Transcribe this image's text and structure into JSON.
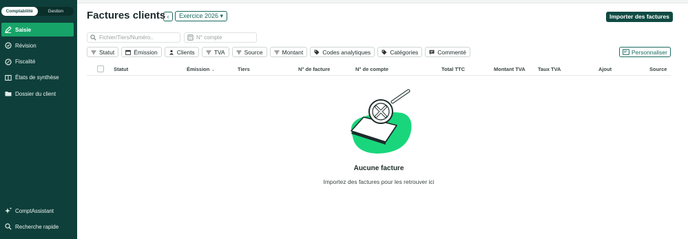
{
  "sidebar": {
    "toggle": {
      "left": "Comptabilité",
      "right": "Gestion"
    },
    "items": [
      {
        "label": "Saisie",
        "icon": "pencil-icon",
        "active": true
      },
      {
        "label": "Révision",
        "icon": "refresh-icon"
      },
      {
        "label": "Fiscalité",
        "icon": "percent-icon"
      },
      {
        "label": "États de synthèse",
        "icon": "book-icon"
      },
      {
        "label": "Dossier du client",
        "icon": "folder-icon"
      }
    ],
    "bottom": [
      {
        "label": "ComptAssistant",
        "icon": "sparkle-icon"
      },
      {
        "label": "Recherche rapide",
        "icon": "search-icon"
      }
    ]
  },
  "header": {
    "title": "Factures clients",
    "back_symbol": "‹",
    "exercise": "Exercice 2026 ▾",
    "import_label": "Importer des factures"
  },
  "search": {
    "placeholder": "Fichier/Tiers/Numéro..",
    "account_placeholder": "N° compte"
  },
  "filters": [
    {
      "label": "Statut",
      "icon": "filter-lines-icon"
    },
    {
      "label": "Émission",
      "icon": "calendar-icon"
    },
    {
      "label": "Clients",
      "icon": "users-icon"
    },
    {
      "label": "TVA",
      "icon": "filter-lines-icon"
    },
    {
      "label": "Source",
      "icon": "filter-lines-icon"
    },
    {
      "label": "Montant",
      "icon": "filter-lines-icon"
    },
    {
      "label": "Codes analytiques",
      "icon": "tag-icon"
    },
    {
      "label": "Catégories",
      "icon": "tag-icon"
    },
    {
      "label": "Commenté",
      "icon": "comment-icon"
    }
  ],
  "customize_label": "Personnaliser",
  "table": {
    "columns": [
      "Statut",
      "Émission",
      "Tiers",
      "N° de facture",
      "N° de compte",
      "Total TTC",
      "Montant TVA",
      "Taux TVA",
      "Ajout",
      "Source"
    ],
    "sort_symbol": "⌄"
  },
  "empty": {
    "title": "Aucune facture",
    "subtitle": "Importez des factures pour les retrouver ici"
  },
  "colors": {
    "sidebar_bg": "#0f3f3a",
    "active_green": "#17a469",
    "primary": "#0f4a43",
    "accent_green": "#19d67c"
  }
}
